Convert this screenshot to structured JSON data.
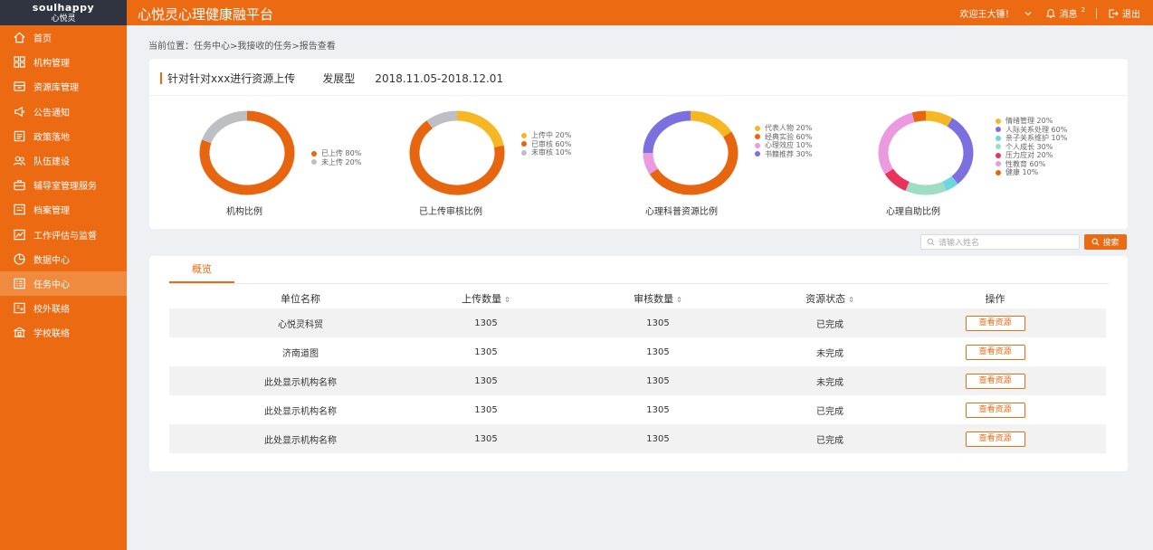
{
  "logo": {
    "en": "soulhappy",
    "cn": "心悦灵"
  },
  "header": {
    "title": "心悦灵心理健康融平台",
    "welcome": "欢迎王大锤！",
    "messages_label": "消息",
    "messages_count": "2",
    "logout_label": "退出"
  },
  "sidebar": {
    "items": [
      {
        "label": "首页",
        "icon": "home-icon"
      },
      {
        "label": "机构管理",
        "icon": "grid-icon"
      },
      {
        "label": "资源库管理",
        "icon": "archive-icon"
      },
      {
        "label": "公告通知",
        "icon": "megaphone-icon"
      },
      {
        "label": "政策落地",
        "icon": "policy-icon"
      },
      {
        "label": "队伍建设",
        "icon": "team-icon"
      },
      {
        "label": "辅导室管理服务",
        "icon": "briefcase-icon"
      },
      {
        "label": "档案管理",
        "icon": "folder-icon"
      },
      {
        "label": "工作评估与监督",
        "icon": "chart-icon"
      },
      {
        "label": "数据中心",
        "icon": "pie-icon"
      },
      {
        "label": "任务中心",
        "icon": "task-icon",
        "active": true
      },
      {
        "label": "校外联络",
        "icon": "link-icon"
      },
      {
        "label": "学校联络",
        "icon": "school-icon"
      }
    ]
  },
  "breadcrumb": "当前位置：任务中心>我接收的任务>报告查看",
  "task": {
    "title": "针对针对xxx进行资源上传",
    "type": "发展型",
    "date_range": "2018.11.05-2018.12.01"
  },
  "colors": {
    "accent": "#ec6a12",
    "gray": "#bdbfc3",
    "yellow": "#f6b722",
    "purple": "#7c6fe0",
    "pink": "#ec9ae0",
    "cyan": "#6ad8dc",
    "red": "#e8345a"
  },
  "charts": [
    {
      "caption": "机构比例",
      "slices": [
        {
          "label": "已上传",
          "value": 80,
          "text": "已上传 80%",
          "color": "#e8650f"
        },
        {
          "label": "未上传",
          "value": 20,
          "text": "未上传 20%",
          "color": "#bdbfc3"
        }
      ]
    },
    {
      "caption": "已上传审核比例",
      "slices": [
        {
          "label": "上传中",
          "value": 20,
          "text": "上传中 20%",
          "color": "#f6b722"
        },
        {
          "label": "已审核",
          "value": 60,
          "text": "已审核 60%",
          "color": "#e8650f"
        },
        {
          "label": "未审核",
          "value": 10,
          "text": "未审核 10%",
          "color": "#bdbfc3"
        }
      ]
    },
    {
      "caption": "心理科普资源比例",
      "slices": [
        {
          "label": "代表人物",
          "value": 20,
          "text": "代表人物 20%",
          "color": "#f6b722"
        },
        {
          "label": "经典实验",
          "value": 60,
          "text": "经典实验 60%",
          "color": "#e8650f"
        },
        {
          "label": "心理效应",
          "value": 10,
          "text": "心理效应 10%",
          "color": "#ec9ae0"
        },
        {
          "label": "书籍推荐",
          "value": 30,
          "text": "书籍推荐 30%",
          "color": "#7c6fe0"
        }
      ]
    },
    {
      "caption": "心理自助比例",
      "slices": [
        {
          "label": "情绪管理",
          "value": 20,
          "text": "情绪管理 20%",
          "color": "#f6b722"
        },
        {
          "label": "人际关系处理",
          "value": 60,
          "text": "人际关系处理 60%",
          "color": "#7c6fe0"
        },
        {
          "label": "亲子关系维护",
          "value": 10,
          "text": "亲子关系维护 10%",
          "color": "#6ad8dc"
        },
        {
          "label": "个人成长",
          "value": 30,
          "text": "个人成长 30%",
          "color": "#9fdcc4"
        },
        {
          "label": "压力应对",
          "value": 20,
          "text": "压力应对 20%",
          "color": "#e8345a"
        },
        {
          "label": "性教育",
          "value": 60,
          "text": "性教育 60%",
          "color": "#ec9ae0"
        },
        {
          "label": "健康",
          "value": 10,
          "text": "健康 10%",
          "color": "#e8650f"
        }
      ]
    }
  ],
  "search": {
    "placeholder": "请输入姓名",
    "button_label": "搜索"
  },
  "table": {
    "tab_label": "概览",
    "headers": [
      "单位名称",
      "上传数量",
      "审核数量",
      "资源状态",
      "操作"
    ],
    "action_label": "查看资源",
    "rows": [
      {
        "name": "心悦灵科贸",
        "upload": "1305",
        "review": "1305",
        "status": "已完成"
      },
      {
        "name": "济南道图",
        "upload": "1305",
        "review": "1305",
        "status": "未完成"
      },
      {
        "name": "此处显示机构名称",
        "upload": "1305",
        "review": "1305",
        "status": "未完成"
      },
      {
        "name": "此处显示机构名称",
        "upload": "1305",
        "review": "1305",
        "status": "已完成"
      },
      {
        "name": "此处显示机构名称",
        "upload": "1305",
        "review": "1305",
        "status": "已完成"
      }
    ]
  }
}
